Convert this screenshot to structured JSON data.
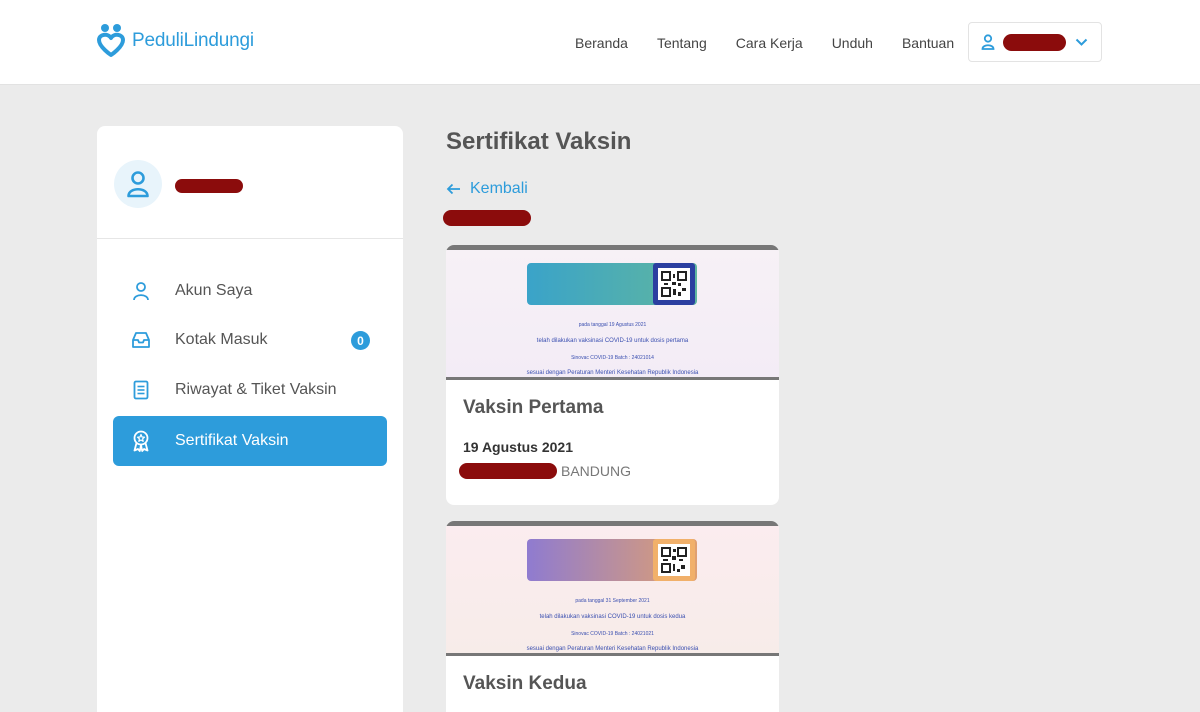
{
  "brand": {
    "name": "PeduliLindungi",
    "color": "#2d9cdb"
  },
  "nav": {
    "items": [
      "Beranda",
      "Tentang",
      "Cara Kerja",
      "Unduh",
      "Bantuan"
    ]
  },
  "user_menu": {
    "icon": "user-icon",
    "name_redacted": true
  },
  "sidebar": {
    "items": [
      {
        "label": "Akun Saya",
        "icon": "user-icon"
      },
      {
        "label": "Kotak Masuk",
        "icon": "inbox-icon",
        "badge": "0"
      },
      {
        "label": "Riwayat & Tiket Vaksin",
        "icon": "document-icon"
      },
      {
        "label": "Sertifikat Vaksin",
        "icon": "certificate-icon",
        "active": true
      }
    ]
  },
  "main": {
    "title": "Sertifikat Vaksin",
    "back_label": "Kembali",
    "cards": [
      {
        "title": "Vaksin Pertama",
        "date": "19 Agustus 2021",
        "location": "BANDUNG",
        "certificate": {
          "line1": "pada tanggal 19 Agustus 2021",
          "line2": "telah dilakukan vaksinasi COVID-19 untuk dosis pertama",
          "line3": "Sinovac COVID-19 Batch : 24021014",
          "line4": "sesuai dengan Peraturan Menteri Kesehatan Republik Indonesia"
        }
      },
      {
        "title": "Vaksin Kedua",
        "certificate": {
          "line1": "pada tanggal 31 September 2021",
          "line2": "telah dilakukan vaksinasi COVID-19 untuk dosis kedua",
          "line3": "Sinovac COVID-19 Batch : 24021021",
          "line4": "sesuai dengan Peraturan Menteri Kesehatan Republik Indonesia"
        }
      }
    ]
  }
}
